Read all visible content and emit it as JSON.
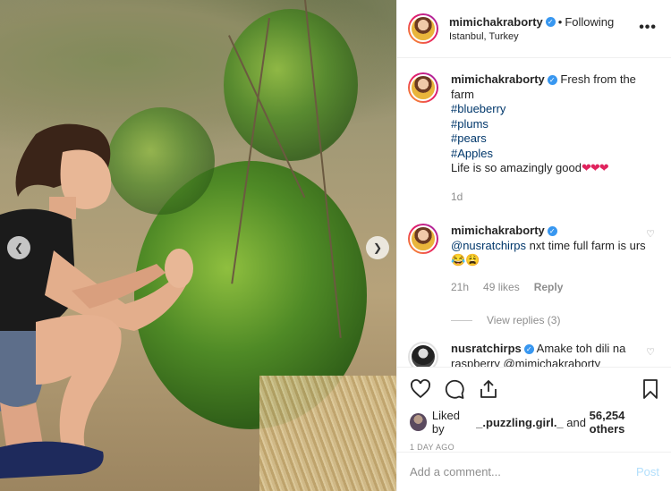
{
  "post": {
    "username": "mimichakraborty",
    "follow_status": "Following",
    "location": "Istanbul, Turkey",
    "more_label": "•••"
  },
  "caption": {
    "username": "mimichakraborty",
    "text_first": "Fresh from the farm",
    "hashtags": [
      "#blueberry",
      "#plums",
      "#pears",
      "#Apples"
    ],
    "text_last": "Life is so amazingly good",
    "hearts": "❤❤❤",
    "time": "1d"
  },
  "comments": [
    {
      "username": "mimichakraborty",
      "mention": "@nusratchirps",
      "text": " nxt time full farm is urs 😂😩",
      "time": "21h",
      "likes": "49 likes",
      "reply_label": "Reply",
      "view_replies": "View replies (3)"
    },
    {
      "username": "nusratchirps",
      "text": "Amake toh dili na",
      "overflow": "raspberry @mimichakraborty"
    }
  ],
  "actions": {
    "likes_prefix": "Liked by ",
    "liked_by_user": "_.puzzling.girl._",
    "likes_middle": " and ",
    "likes_count": "56,254 others",
    "date": "1 day ago"
  },
  "add_comment": {
    "placeholder": "Add a comment...",
    "post_label": "Post"
  },
  "colors": {
    "verified": "#3897f0",
    "link": "#00376b",
    "heart": "#e0245e",
    "post_button": "#b2dffc"
  }
}
